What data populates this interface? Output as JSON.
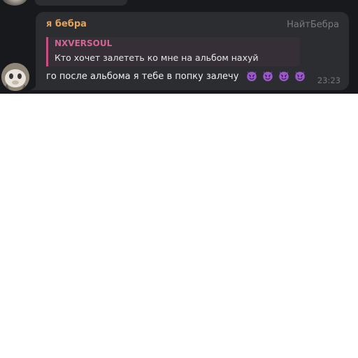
{
  "message": {
    "author": "я бебра",
    "tag": "НайтБебра",
    "reply": {
      "author": "NXVERSOUL",
      "text": "Кто хочет залететь ко мне на альбом нахуй"
    },
    "text": "го после альбома я тебе в попку залечу",
    "emojis": [
      "smiling-imp-icon",
      "smiling-imp-icon",
      "smiling-imp-icon",
      "smiling-imp-icon"
    ],
    "time": "23:23"
  },
  "colors": {
    "background": "#18191d",
    "bubble": "#2b2d31",
    "author": "#e5a45a",
    "reply_accent": "#c64f86",
    "emoji": "#9b59c9"
  }
}
